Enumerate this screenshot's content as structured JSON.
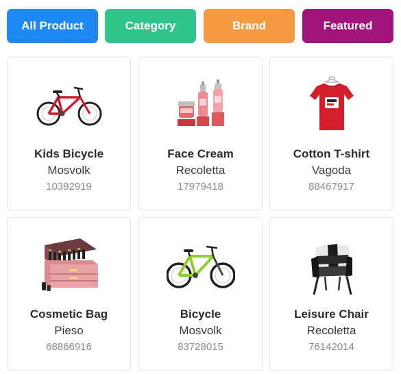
{
  "filters": [
    {
      "label": "All Product",
      "color": "#1e88f5"
    },
    {
      "label": "Category",
      "color": "#2fc48b"
    },
    {
      "label": "Brand",
      "color": "#f59a43"
    },
    {
      "label": "Featured",
      "color": "#a0147a"
    }
  ],
  "products": [
    {
      "name": "Kids Bicycle",
      "brand": "Mosvolk",
      "code": "10392919",
      "image": "red-bicycle-image"
    },
    {
      "name": "Face Cream",
      "brand": "Recoletta",
      "code": "17979418",
      "image": "face-cream-bottles-image"
    },
    {
      "name": "Cotton T-shirt",
      "brand": "Vagoda",
      "code": "88467917",
      "image": "red-tshirt-image"
    },
    {
      "name": "Cosmetic Bag",
      "brand": "Pieso",
      "code": "68866916",
      "image": "cosmetic-case-image"
    },
    {
      "name": "Bicycle",
      "brand": "Mosvolk",
      "code": "83728015",
      "image": "green-bicycle-image"
    },
    {
      "name": "Leisure Chair",
      "brand": "Recoletta",
      "code": "76142014",
      "image": "black-white-chair-image"
    }
  ]
}
